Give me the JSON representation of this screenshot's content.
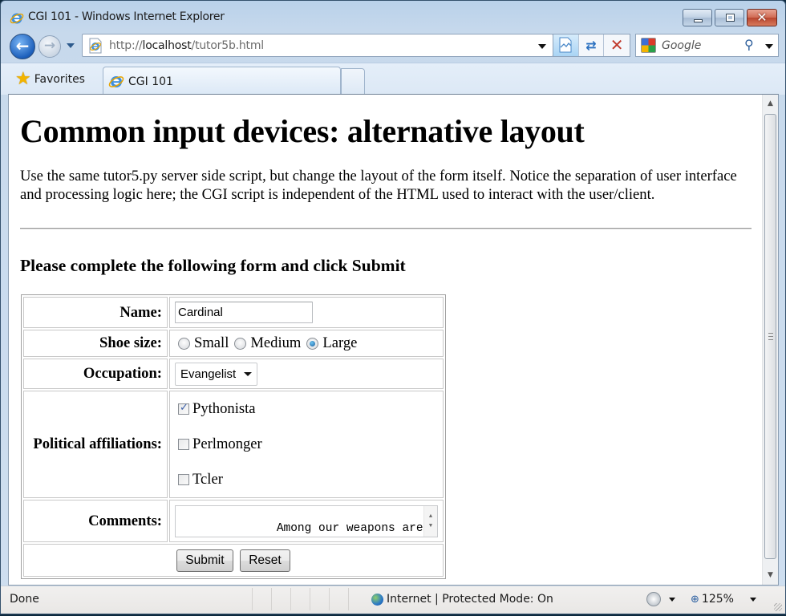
{
  "window": {
    "title": "CGI 101 - Windows Internet Explorer",
    "controls": {
      "minimize": "minimize",
      "maximize": "maximize",
      "close": "✕"
    }
  },
  "nav": {
    "back_glyph": "←",
    "forward_glyph": "→",
    "address_prefix": "http://",
    "address_host": "localhost",
    "address_path": "/tutor5b.html",
    "tools": {
      "refresh_glyph": "⇄",
      "stop_glyph": "✕"
    },
    "search_placeholder": "Google",
    "search_glyph": "⚲"
  },
  "favorites_bar": {
    "favorites_label": "Favorites",
    "star_glyph": "★",
    "tabs": [
      {
        "label": "CGI 101",
        "active": true
      }
    ]
  },
  "page": {
    "heading": "Common input devices: alternative layout",
    "intro": "Use the same tutor5.py server side script, but change the layout of the form itself. Notice the separation of user interface and processing logic here; the CGI script is independent of the HTML used to interact with the user/client.",
    "form_heading": "Please complete the following form and click Submit",
    "form": {
      "name": {
        "label": "Name:",
        "value": "Cardinal"
      },
      "shoe_size": {
        "label": "Shoe size:",
        "options": [
          {
            "label": "Small",
            "checked": false
          },
          {
            "label": "Medium",
            "checked": false
          },
          {
            "label": "Large",
            "checked": true
          }
        ]
      },
      "occupation": {
        "label": "Occupation:",
        "selected": "Evangelist"
      },
      "affiliations": {
        "label": "Political affiliations:",
        "options": [
          {
            "label": "Pythonista",
            "checked": true
          },
          {
            "label": "Perlmonger",
            "checked": false
          },
          {
            "label": "Tcler",
            "checked": false
          }
        ]
      },
      "comments": {
        "label": "Comments:",
        "value": "Among our weapons are these:\n... and nice red uniforms."
      },
      "submit_label": "Submit",
      "reset_label": "Reset"
    }
  },
  "scrollbar": {
    "up_glyph": "▲",
    "down_glyph": "▼"
  },
  "status": {
    "text": "Done",
    "zone": "Internet | Protected Mode: On",
    "zoom": "125%"
  }
}
